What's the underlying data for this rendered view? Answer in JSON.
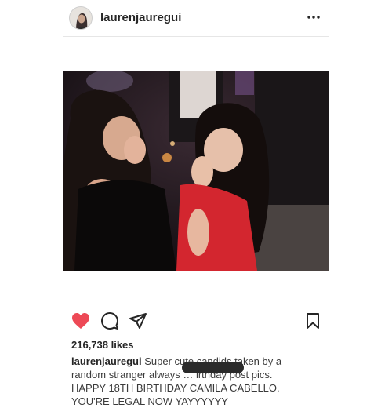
{
  "header": {
    "username": "laurenjauregui",
    "avatar_icon": "profile-avatar-icon",
    "more_icon": "more-options-icon"
  },
  "post": {
    "photo_description_icon": "post-photo",
    "actions": {
      "like_icon": "heart-filled-icon",
      "comment_icon": "comment-icon",
      "share_icon": "share-icon",
      "save_icon": "bookmark-icon",
      "like_color": "#ed4956"
    },
    "likes": "216,738 likes",
    "caption": {
      "username": "laurenjauregui",
      "text": "Super cute candids taken by a random stranger always … irthday post pics. HAPPY 18TH BIRTHDAY CAMILA CABELLO. YOU'RE LEGAL NOW YAYYYYYY"
    }
  }
}
